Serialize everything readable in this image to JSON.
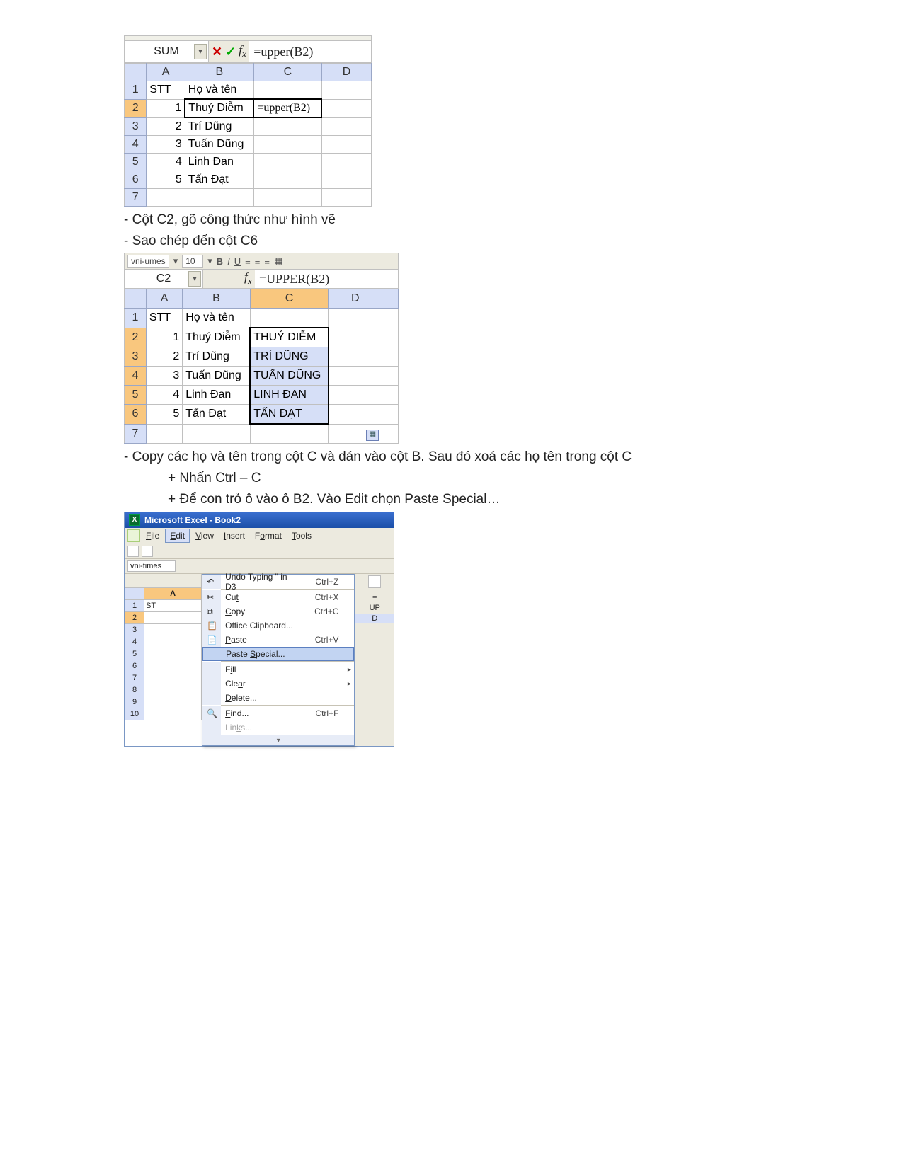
{
  "shot1": {
    "namebox": "SUM",
    "formula": "=upper(B2)",
    "cols": [
      "A",
      "B",
      "C",
      "D"
    ],
    "rows": [
      {
        "n": "1",
        "a": "STT",
        "b": "Họ và tên",
        "c": "",
        "d": ""
      },
      {
        "n": "2",
        "a": "1",
        "b": "Thuý Diễm",
        "c": "=upper(B2)",
        "d": ""
      },
      {
        "n": "3",
        "a": "2",
        "b": "Trí Dũng",
        "c": "",
        "d": ""
      },
      {
        "n": "4",
        "a": "3",
        "b": "Tuấn Dũng",
        "c": "",
        "d": ""
      },
      {
        "n": "5",
        "a": "4",
        "b": "Linh Đan",
        "c": "",
        "d": ""
      },
      {
        "n": "6",
        "a": "5",
        "b": "Tấn Đạt",
        "c": "",
        "d": ""
      },
      {
        "n": "7",
        "a": "",
        "b": "",
        "c": "",
        "d": ""
      }
    ]
  },
  "text1": "- Cột C2, gõ công thức như hình vẽ",
  "text2": "- Sao chép đến cột C6",
  "shot2": {
    "font_name": "vni-umes",
    "font_size": "10",
    "namebox": "C2",
    "formula": "=UPPER(B2)",
    "cols": [
      "A",
      "B",
      "C",
      "D"
    ],
    "rows": [
      {
        "n": "1",
        "a": "STT",
        "b": "Họ và tên",
        "c": "",
        "d": ""
      },
      {
        "n": "2",
        "a": "1",
        "b": "Thuý Diễm",
        "c": "THUÝ DIỄM",
        "d": ""
      },
      {
        "n": "3",
        "a": "2",
        "b": "Trí Dũng",
        "c": "TRÍ DŨNG",
        "d": ""
      },
      {
        "n": "4",
        "a": "3",
        "b": "Tuấn Dũng",
        "c": "TUẤN DŨNG",
        "d": ""
      },
      {
        "n": "5",
        "a": "4",
        "b": "Linh Đan",
        "c": "LINH ĐAN",
        "d": ""
      },
      {
        "n": "6",
        "a": "5",
        "b": "Tấn Đạt",
        "c": "TẤN ĐẠT",
        "d": ""
      },
      {
        "n": "7",
        "a": "",
        "b": "",
        "c": "",
        "d": ""
      }
    ]
  },
  "text3": "- Copy các họ và tên trong cột C và dán vào cột B. Sau đó xoá các họ tên trong cột C",
  "text4": "+ Nhấn Ctrl – C",
  "text5": "+ Để con trỏ ô vào ô B2. Vào Edit chọn Paste Special…",
  "shot3": {
    "title": "Microsoft Excel - Book2",
    "menus": [
      "File",
      "Edit",
      "View",
      "Insert",
      "Format",
      "Tools"
    ],
    "font_name": "vni-times",
    "right_label": "UP",
    "grid": {
      "cols": [
        "A"
      ],
      "rows": [
        "1",
        "2",
        "3",
        "4",
        "5",
        "6",
        "7",
        "8",
        "9",
        "10"
      ],
      "a1": "ST"
    },
    "menu_items": [
      {
        "label": "Undo Typing \" in D3",
        "shortcut": "Ctrl+Z",
        "disabled": false,
        "sub": false
      },
      {
        "label": "Cut",
        "shortcut": "Ctrl+X",
        "disabled": false,
        "sub": false,
        "sep_before": true,
        "icon": "✂"
      },
      {
        "label": "Copy",
        "shortcut": "Ctrl+C",
        "disabled": false,
        "sub": false,
        "icon": "⧉"
      },
      {
        "label": "Office Clipboard...",
        "shortcut": "",
        "disabled": false,
        "sub": false,
        "icon": "📋"
      },
      {
        "label": "Paste",
        "shortcut": "Ctrl+V",
        "disabled": false,
        "sub": false,
        "icon": "📄"
      },
      {
        "label": "Paste Special...",
        "shortcut": "",
        "disabled": false,
        "sub": false,
        "sel": true
      },
      {
        "label": "Fill",
        "shortcut": "",
        "disabled": false,
        "sub": true,
        "sep_before": true
      },
      {
        "label": "Clear",
        "shortcut": "",
        "disabled": false,
        "sub": true
      },
      {
        "label": "Delete...",
        "shortcut": "",
        "disabled": false,
        "sub": false
      },
      {
        "label": "Find...",
        "shortcut": "Ctrl+F",
        "disabled": false,
        "sub": false,
        "sep_before": true,
        "icon": "🔍"
      },
      {
        "label": "Links...",
        "shortcut": "",
        "disabled": true,
        "sub": false
      }
    ]
  }
}
